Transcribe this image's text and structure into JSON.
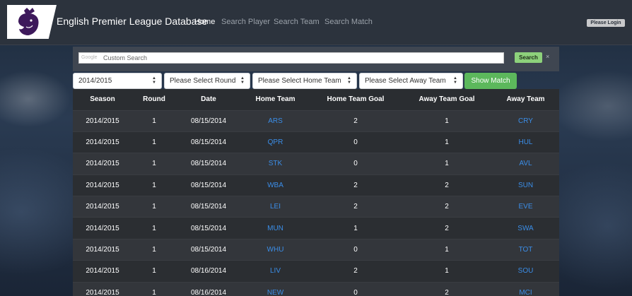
{
  "nav": {
    "brand": "English Premier League Database",
    "items": [
      {
        "label": "Home",
        "active": true
      },
      {
        "label": "Search Player",
        "active": false
      },
      {
        "label": "Search Team",
        "active": false
      },
      {
        "label": "Search Match",
        "active": false
      }
    ],
    "login_label": "Please Login"
  },
  "search": {
    "provider_label": "Google",
    "placeholder": "Custom Search",
    "button_label": "Search",
    "clear_label": "×"
  },
  "filters": {
    "season": "2014/2015",
    "round": "Please Select Round",
    "home_team": "Please Select Home Team",
    "away_team": "Please Select Away Team",
    "show_button": "Show Match"
  },
  "table": {
    "columns": [
      "Season",
      "Round",
      "Date",
      "Home Team",
      "Home Team Goal",
      "Away Team Goal",
      "Away Team"
    ],
    "rows": [
      [
        "2014/2015",
        "1",
        "08/15/2014",
        "ARS",
        "2",
        "1",
        "CRY"
      ],
      [
        "2014/2015",
        "1",
        "08/15/2014",
        "QPR",
        "0",
        "1",
        "HUL"
      ],
      [
        "2014/2015",
        "1",
        "08/15/2014",
        "STK",
        "0",
        "1",
        "AVL"
      ],
      [
        "2014/2015",
        "1",
        "08/15/2014",
        "WBA",
        "2",
        "2",
        "SUN"
      ],
      [
        "2014/2015",
        "1",
        "08/15/2014",
        "LEI",
        "2",
        "2",
        "EVE"
      ],
      [
        "2014/2015",
        "1",
        "08/15/2014",
        "MUN",
        "1",
        "2",
        "SWA"
      ],
      [
        "2014/2015",
        "1",
        "08/15/2014",
        "WHU",
        "0",
        "1",
        "TOT"
      ],
      [
        "2014/2015",
        "1",
        "08/16/2014",
        "LIV",
        "2",
        "1",
        "SOU"
      ],
      [
        "2014/2015",
        "1",
        "08/16/2014",
        "NEW",
        "0",
        "2",
        "MCI"
      ]
    ]
  },
  "colors": {
    "navbar": "#2c333d",
    "link": "#3b8ee8",
    "show_button": "#5cb85c",
    "search_button": "#8dd17b",
    "logo_purple": "#3d195b"
  },
  "icons": {
    "logo": "premier-league-lion-icon",
    "select_caret": "updown-caret-icon",
    "clear": "close-icon"
  }
}
